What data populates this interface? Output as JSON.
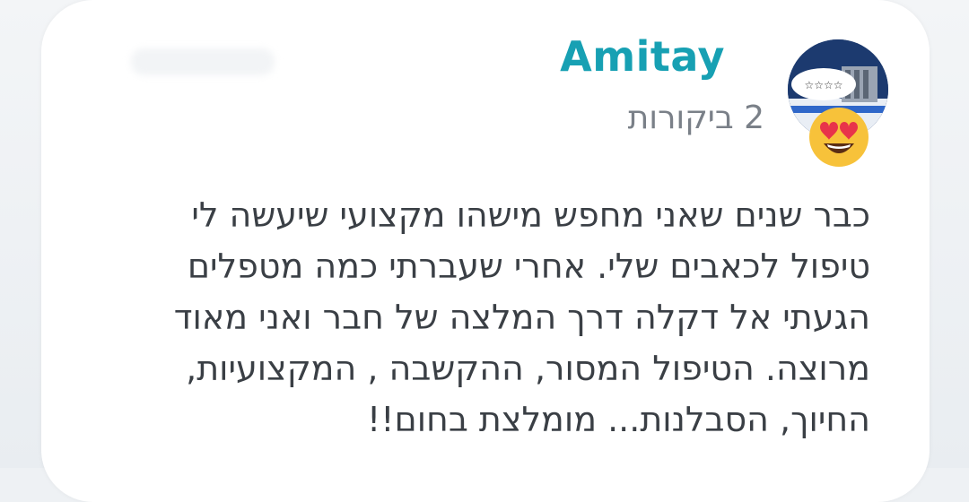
{
  "review": {
    "author_name": "Amitay",
    "review_count_label": "2 ביקורות",
    "avatar_icon": "user-avatar-flag-icon",
    "reaction_icon": "heart-eyes-emoji-icon",
    "text_lines": [
      "כבר שנים שאני מחפש מישהו מקצועי שיעשה לי",
      "טיפול לכאבים שלי. אחרי שעברתי כמה מטפלים",
      "הגעתי אל דקלה דרך המלצה של חבר ואני מאוד",
      "מרוצה. הטיפול המסור, ההקשבה , המקצועיות,",
      "החיוך, הסבלנות... מומלצת בחום!!"
    ]
  },
  "colors": {
    "author": "#17a0b3",
    "muted": "#7a8088",
    "body_text": "#3a3f45",
    "card": "#ffffff",
    "emoji_face": "#f7c23a",
    "emoji_heart": "#e8334a"
  }
}
